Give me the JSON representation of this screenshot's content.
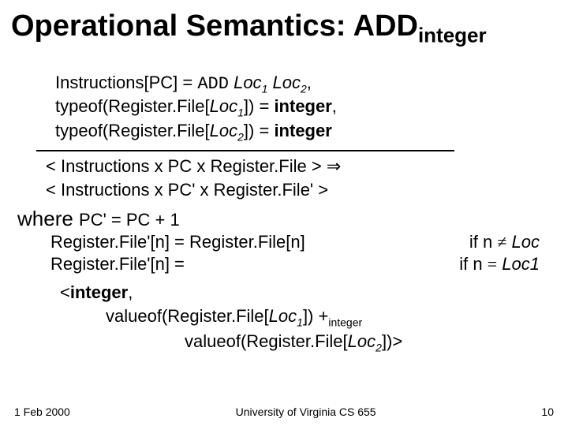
{
  "title": {
    "main": "Operational Semantics: ADD",
    "sub": "integer"
  },
  "premise": {
    "line1": {
      "a": "Instructions[PC] = ",
      "b": "ADD",
      "c": " Loc",
      "d": "1",
      "e": " Loc",
      "f": "2",
      "g": ","
    },
    "line2": {
      "a": "typeof(Register.File[",
      "b": "Loc",
      "c": "1",
      "d": "]) = ",
      "e": "integer",
      "f": ","
    },
    "line3": {
      "a": "typeof(Register.File[",
      "b": "Loc",
      "c": "2",
      "d": "]) = ",
      "e": "integer"
    }
  },
  "conclusion": {
    "line1": {
      "a": "< Instructions x PC x Register.File > ",
      "b": "⇒"
    },
    "line2": "< Instructions x PC' x Register.File' >"
  },
  "where": {
    "label": "where ",
    "pc": "PC' = PC + 1"
  },
  "rf1": {
    "left": "Register.File'[n] = Register.File[n]",
    "right_a": "if n ",
    "right_b": "≠",
    "right_c": " Loc"
  },
  "rf2": {
    "left": "Register.File'[n] =",
    "right_a": "if n ",
    "right_b": "=",
    "right_c": " Loc",
    "right_d": "1"
  },
  "detail": {
    "l1a": "<",
    "l1b": "integer",
    "l1c": ",",
    "l2a": "valueof(Register.File[",
    "l2b": "Loc",
    "l2c": "1",
    "l2d": "]) +",
    "l2e": "integer",
    "l3a": "valueof(Register.File[",
    "l3b": "Loc",
    "l3c": "2",
    "l3d": "])>"
  },
  "footer": {
    "date": "1 Feb 2000",
    "center": "University of Virginia CS 655",
    "page": "10"
  }
}
